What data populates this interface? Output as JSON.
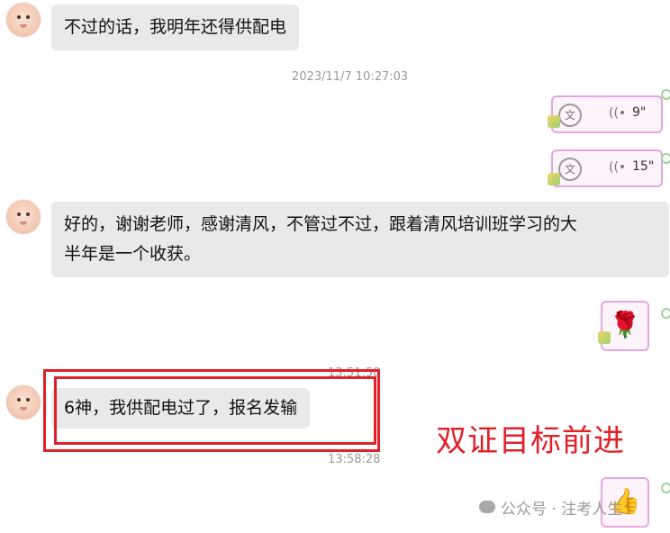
{
  "messages": {
    "m1": "不过的话，我明年还得供配电",
    "m2_line1": "好的，谢谢老师，感谢清风，不管过不过，跟着清风培训班学习的大",
    "m2_line2": "半年是一个收获。",
    "m3": "6神，我供配电过了，报名发输"
  },
  "timestamps": {
    "t1": "2023/11/7 10:27:03",
    "t2": "13:51:58",
    "t3": "13:58:28"
  },
  "voice": {
    "v1_duration": "9\"",
    "v2_duration": "15\"",
    "translate_glyph": "文",
    "wave_glyph": "((•"
  },
  "stickers": {
    "rose": "🌹",
    "thumbs": "👍"
  },
  "annotation": {
    "slogan": "双证目标前进"
  },
  "watermark": {
    "text": "公众号 · 注考人生"
  },
  "colors": {
    "highlight_red": "#e1202a",
    "bubble_gray": "#e9e9e9",
    "voice_border": "#e6a6e0"
  }
}
